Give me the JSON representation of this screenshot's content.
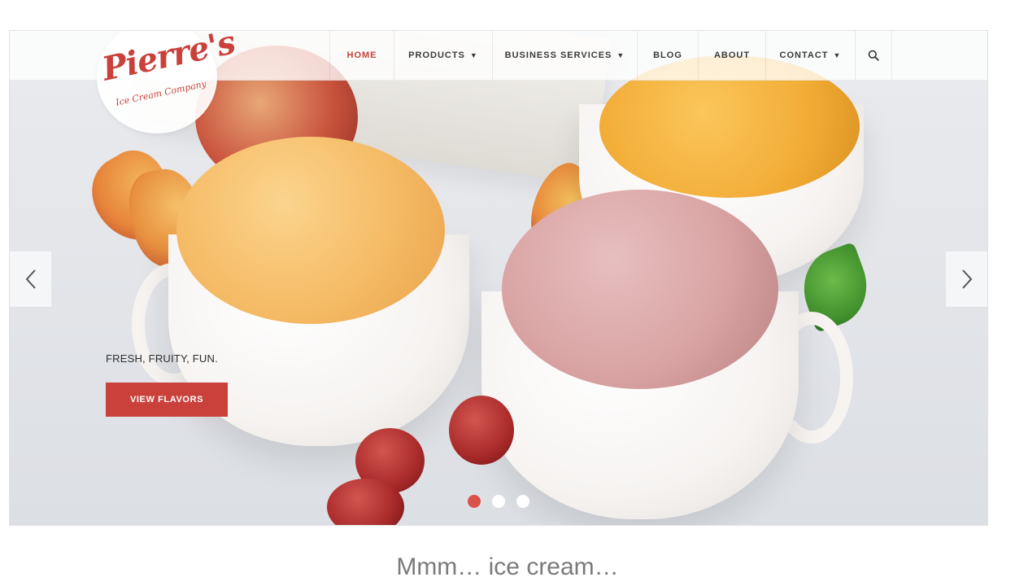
{
  "nav": {
    "items": [
      {
        "label": "HOME",
        "active": true,
        "dropdown": false
      },
      {
        "label": "PRODUCTS",
        "active": false,
        "dropdown": true
      },
      {
        "label": "BUSINESS SERVICES",
        "active": false,
        "dropdown": true
      },
      {
        "label": "BLOG",
        "active": false,
        "dropdown": false
      },
      {
        "label": "ABOUT",
        "active": false,
        "dropdown": false
      },
      {
        "label": "CONTACT",
        "active": false,
        "dropdown": true
      }
    ],
    "search_icon": "search-icon"
  },
  "logo": {
    "main": "Pierre's",
    "sub": "Ice Cream Company"
  },
  "hero": {
    "caption": "FRESH, FRUITY, FUN.",
    "cta_label": "VIEW FLAVORS",
    "slides_total": 3,
    "active_slide": 1
  },
  "colors": {
    "accent": "#c9413a",
    "dot_active": "#d9534a",
    "dot_inactive": "#ffffff"
  },
  "footer_caption": "Mmm… ice cream…"
}
